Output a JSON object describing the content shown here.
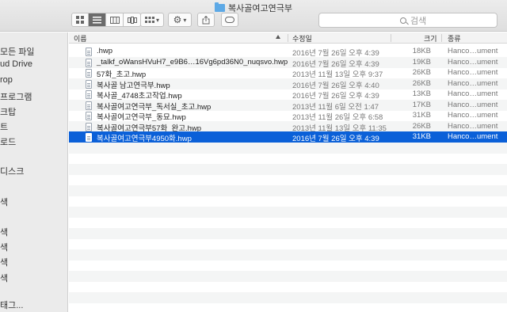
{
  "window": {
    "title": "복사골여고연극부"
  },
  "toolbar": {
    "gear_caret": "▾",
    "arrange_caret": "▾"
  },
  "search": {
    "placeholder": "검색"
  },
  "sidebar": {
    "items": [
      {
        "label": "모든 파일"
      },
      {
        "label": "ud Drive"
      },
      {
        "label": "rop"
      },
      {
        "label": "프로그램"
      },
      {
        "label": "크탑"
      },
      {
        "label": "트"
      },
      {
        "label": "로드"
      },
      {
        "label": "디스크"
      },
      {
        "label": "색"
      },
      {
        "label": "색"
      },
      {
        "label": "색"
      },
      {
        "label": "색"
      },
      {
        "label": "색"
      },
      {
        "label": "태그..."
      }
    ]
  },
  "columns": {
    "name": "이름",
    "date": "수정일",
    "size": "크기",
    "kind": "종류"
  },
  "files": [
    {
      "name": ".hwp",
      "date": "2016년 7월 26일 오후 4:39",
      "size": "18KB",
      "kind": "Hanco…ument"
    },
    {
      "name": "_talkf_oWansHVuH7_e9B6…16Vg6pd36N0_nuqsvo.hwp",
      "date": "2016년 7월 26일 오후 4:39",
      "size": "19KB",
      "kind": "Hanco…ument"
    },
    {
      "name": "57화_초고.hwp",
      "date": "2013년 11월 13일 오후 9:37",
      "size": "26KB",
      "kind": "Hanco…ument"
    },
    {
      "name": "복사골 남고연극부.hwp",
      "date": "2016년 7월 26일 오후 4:40",
      "size": "26KB",
      "kind": "Hanco…ument"
    },
    {
      "name": "복사골_4748초고작업.hwp",
      "date": "2016년 7월 26일 오후 4:39",
      "size": "13KB",
      "kind": "Hanco…ument"
    },
    {
      "name": "복사골여고연극부_독서실_초고.hwp",
      "date": "2013년 11월 6일 오전 1:47",
      "size": "17KB",
      "kind": "Hanco…ument"
    },
    {
      "name": "복사골여고연극부_동묘.hwp",
      "date": "2013년 11월 26일 오후 6:58",
      "size": "31KB",
      "kind": "Hanco…ument"
    },
    {
      "name": "복사골여고연극부57화_완고.hwp",
      "date": "2013년 11월 13일 오후 11:35",
      "size": "26KB",
      "kind": "Hanco…ument"
    },
    {
      "name": "복사골여고연극부4950화.hwp",
      "date": "2016년 7월 26일 오후 4:39",
      "size": "31KB",
      "kind": "Hanco…ument",
      "selected": true
    }
  ]
}
